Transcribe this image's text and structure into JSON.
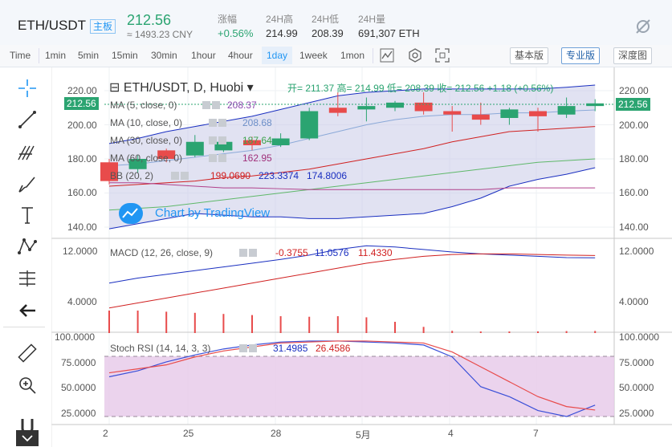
{
  "header": {
    "pair": "ETH/USDT",
    "tag": "主板",
    "price": "212.56",
    "price_cny": "≈ 1493.23 CNY",
    "stats": [
      {
        "label": "涨幅",
        "value": "+0.56%"
      },
      {
        "label": "24H高",
        "value": "214.99"
      },
      {
        "label": "24H低",
        "value": "208.39"
      },
      {
        "label": "24H量",
        "value": "691,307 ETH"
      }
    ]
  },
  "toolbar": {
    "timeframes": [
      "Time",
      "1min",
      "5min",
      "15min",
      "30min",
      "1hour",
      "4hour",
      "1day",
      "1week",
      "1mon"
    ],
    "active_timeframe": "1day",
    "views": [
      "基本版",
      "专业版",
      "深度图"
    ],
    "active_view": "专业版"
  },
  "sidebar_icons": [
    "crosshair-icon",
    "trend-line-icon",
    "fib-icon",
    "brush-icon",
    "text-icon",
    "pattern-icon",
    "measure-icon",
    "back-arrow-icon",
    "ruler-icon",
    "zoom-icon",
    "magnet-icon"
  ],
  "legend": {
    "symbol": "ETH/USDT, D, Huobi",
    "ohlc": "开= 211.37  高= 214.99  低= 208.39  收= 212.56  +1.18 (+0.56%)",
    "ma5_label": "MA (5, close, 0)",
    "ma5_value": "208.37",
    "ma10_label": "MA (10, close, 0)",
    "ma10_value": "208.68",
    "ma30_label": "MA (30, close, 0)",
    "ma30_value": "187.64",
    "ma60_label": "MA (60, close, 0)",
    "ma60_value": "162.95",
    "bb_label": "BB (20, 2)",
    "bb_values": [
      "199.0690",
      "223.3374",
      "174.8006"
    ],
    "macd_label": "MACD (12, 26, close, 9)",
    "macd_values": [
      "-0.3755",
      "11.0576",
      "11.4330"
    ],
    "rsi_label": "Stoch RSI (14, 14, 3, 3)",
    "rsi_values": [
      "31.4985",
      "26.4586"
    ]
  },
  "price_badge": "212.56",
  "watermark": "Chart by TradingView",
  "axes": {
    "price": [
      "220.00",
      "200.00",
      "180.00",
      "160.00",
      "140.00"
    ],
    "macd": [
      "12.0000",
      "4.0000"
    ],
    "rsi": [
      "100.0000",
      "75.0000",
      "50.0000",
      "25.0000"
    ],
    "x": [
      "2",
      "25",
      "28",
      "5月",
      "4",
      "7"
    ]
  },
  "colors": {
    "up": "#2ba471",
    "down": "#e84b4b",
    "accent": "#2196f3"
  },
  "chart_data": {
    "type": "line",
    "candles": [
      {
        "o": 178,
        "c": 167,
        "h": 180,
        "l": 165
      },
      {
        "o": 174,
        "c": 180,
        "h": 182,
        "l": 172
      },
      {
        "o": 185,
        "c": 180,
        "h": 186,
        "l": 178
      },
      {
        "o": 182,
        "c": 190,
        "h": 194,
        "l": 181
      },
      {
        "o": 185,
        "c": 190,
        "h": 192,
        "l": 184
      },
      {
        "o": 191,
        "c": 188,
        "h": 193,
        "l": 185
      },
      {
        "o": 188,
        "c": 192,
        "h": 195,
        "l": 187
      },
      {
        "o": 192,
        "c": 208,
        "h": 210,
        "l": 191
      },
      {
        "o": 210,
        "c": 207,
        "h": 219,
        "l": 205
      },
      {
        "o": 209,
        "c": 211,
        "h": 216,
        "l": 202
      },
      {
        "o": 210,
        "c": 213,
        "h": 214,
        "l": 208
      },
      {
        "o": 213,
        "c": 208,
        "h": 219,
        "l": 206
      },
      {
        "o": 208,
        "c": 206,
        "h": 211,
        "l": 196
      },
      {
        "o": 206,
        "c": 203,
        "h": 213,
        "l": 200
      },
      {
        "o": 204,
        "c": 209,
        "h": 210,
        "l": 200
      },
      {
        "o": 208,
        "c": 205,
        "h": 210,
        "l": 196
      },
      {
        "o": 206,
        "c": 211,
        "h": 216,
        "l": 204
      },
      {
        "o": 211,
        "c": 212.56,
        "h": 215,
        "l": 208
      }
    ]
  }
}
